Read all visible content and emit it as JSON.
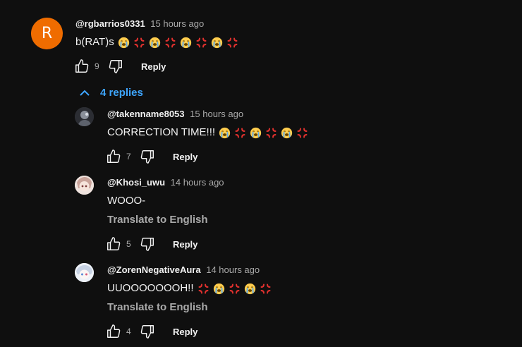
{
  "comments": [
    {
      "author": "@rgbarrios0331",
      "time": "15 hours ago",
      "avatar_letter": "R",
      "text": "b(RAT)s",
      "emojis": [
        "loudly-crying-face",
        "anger-symbol",
        "loudly-crying-face",
        "anger-symbol",
        "loudly-crying-face",
        "anger-symbol",
        "loudly-crying-face",
        "anger-symbol"
      ],
      "likes": "9",
      "reply_label": "Reply"
    }
  ],
  "replies_toggle": {
    "label": "4 replies",
    "icon": "chevron-up-icon"
  },
  "replies": [
    {
      "author": "@takenname8053",
      "time": "15 hours ago",
      "text": "CORRECTION TIME!!!",
      "emojis": [
        "loudly-crying-face",
        "anger-symbol",
        "loudly-crying-face",
        "anger-symbol",
        "loudly-crying-face",
        "anger-symbol"
      ],
      "likes": "7",
      "reply_label": "Reply",
      "avatar_color": "#3a3d44"
    },
    {
      "author": "@Khosi_uwu",
      "time": "14 hours ago",
      "text": "WOOO-",
      "translate_label": "Translate to English",
      "likes": "5",
      "reply_label": "Reply",
      "avatar_color": "#e9d6d0"
    },
    {
      "author": "@ZorenNegativeAura",
      "time": "14 hours ago",
      "text": "UUOOOOOOOH!!",
      "emojis": [
        "anger-symbol",
        "loudly-crying-face",
        "anger-symbol",
        "loudly-crying-face",
        "anger-symbol"
      ],
      "translate_label": "Translate to English",
      "likes": "4",
      "reply_label": "Reply",
      "avatar_color": "#dfe6f2"
    }
  ]
}
